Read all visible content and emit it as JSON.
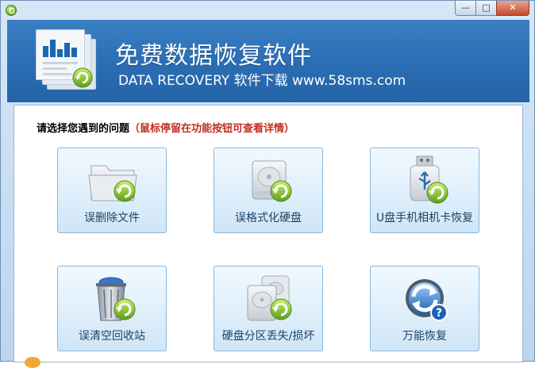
{
  "window": {
    "controls": {
      "minimize": "—",
      "maximize": "□",
      "close": "✕"
    }
  },
  "header": {
    "title": "免费数据恢复软件",
    "subtitle": "DATA RECOVERY 软件下载 www.58sms.com"
  },
  "main": {
    "prompt": "请选择您遇到的问题",
    "prompt_hint": "（鼠标停留在功能按钮可查看详情）",
    "buttons": [
      {
        "label": "误删除文件",
        "icon": "folder-recover-icon"
      },
      {
        "label": "误格式化硬盘",
        "icon": "harddisk-recover-icon"
      },
      {
        "label": "U盘手机相机卡恢复",
        "icon": "usb-drive-recover-icon"
      },
      {
        "label": "误清空回收站",
        "icon": "recycle-bin-recover-icon"
      },
      {
        "label": "硬盘分区丢失/损坏",
        "icon": "partition-recover-icon"
      },
      {
        "label": "万能恢复",
        "icon": "universal-recover-icon"
      }
    ]
  },
  "colors": {
    "header_blue": "#2b6db3",
    "button_border": "#86b6dc",
    "hint_red": "#c0301f",
    "recover_badge_green": "#7fbf2c"
  }
}
